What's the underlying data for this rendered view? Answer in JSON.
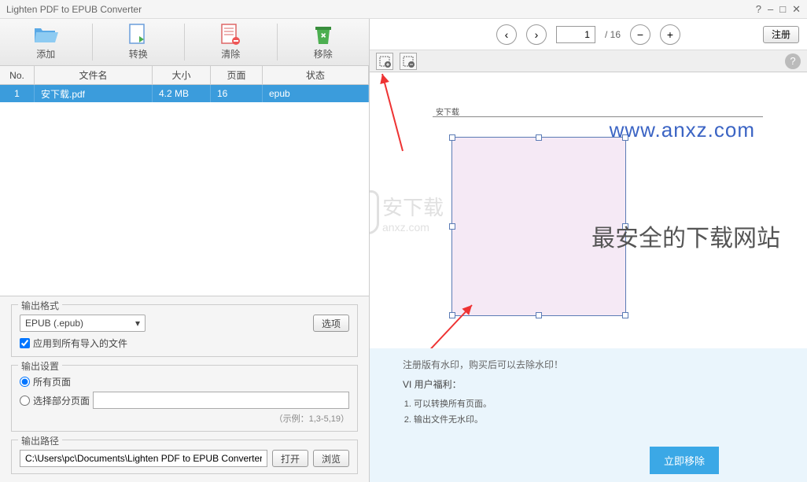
{
  "titlebar": {
    "title": "Lighten PDF to EPUB Converter",
    "help": "?",
    "min": "–",
    "max": "□",
    "close": "✕"
  },
  "toolbar": {
    "add": "添加",
    "convert": "转换",
    "clear": "清除",
    "remove": "移除"
  },
  "table": {
    "headers": {
      "no": "No.",
      "name": "文件名",
      "size": "大小",
      "page": "页面",
      "status": "状态"
    },
    "rows": [
      {
        "no": "1",
        "name": "安下载.pdf",
        "size": "4.2 MB",
        "page": "16",
        "status": "epub"
      }
    ]
  },
  "settings": {
    "format_legend": "输出格式",
    "format_value": "EPUB (.epub)",
    "options_btn": "选项",
    "apply_all": "应用到所有导入的文件",
    "output_legend": "输出设置",
    "all_pages": "所有页面",
    "partial_pages": "选择部分页面",
    "hint": "（示例：1,3-5,19）",
    "path_legend": "输出路径",
    "path_value": "C:\\Users\\pc\\Documents\\Lighten PDF to EPUB Converter",
    "open_btn": "打开",
    "browse_btn": "浏览"
  },
  "right_toolbar": {
    "prev": "‹",
    "next": "›",
    "page_current": "1",
    "page_total": "/ 16",
    "zoom_out": "−",
    "zoom_in": "+",
    "register": "注册"
  },
  "crop_toolbar": {
    "help": "?"
  },
  "preview": {
    "doc_header": "安下载"
  },
  "promo": {
    "title": "注册版有水印，购买后可以去除水印！",
    "sub": "VI 用户福利：",
    "li1": "可以转换所有页面。",
    "li2": "输出文件无水印。",
    "btn": "立即移除"
  },
  "watermark": {
    "url": "www.anxz.com",
    "text": "最安全的下载网站",
    "logo_text": "安下载",
    "logo_sub": "anxz.com"
  }
}
